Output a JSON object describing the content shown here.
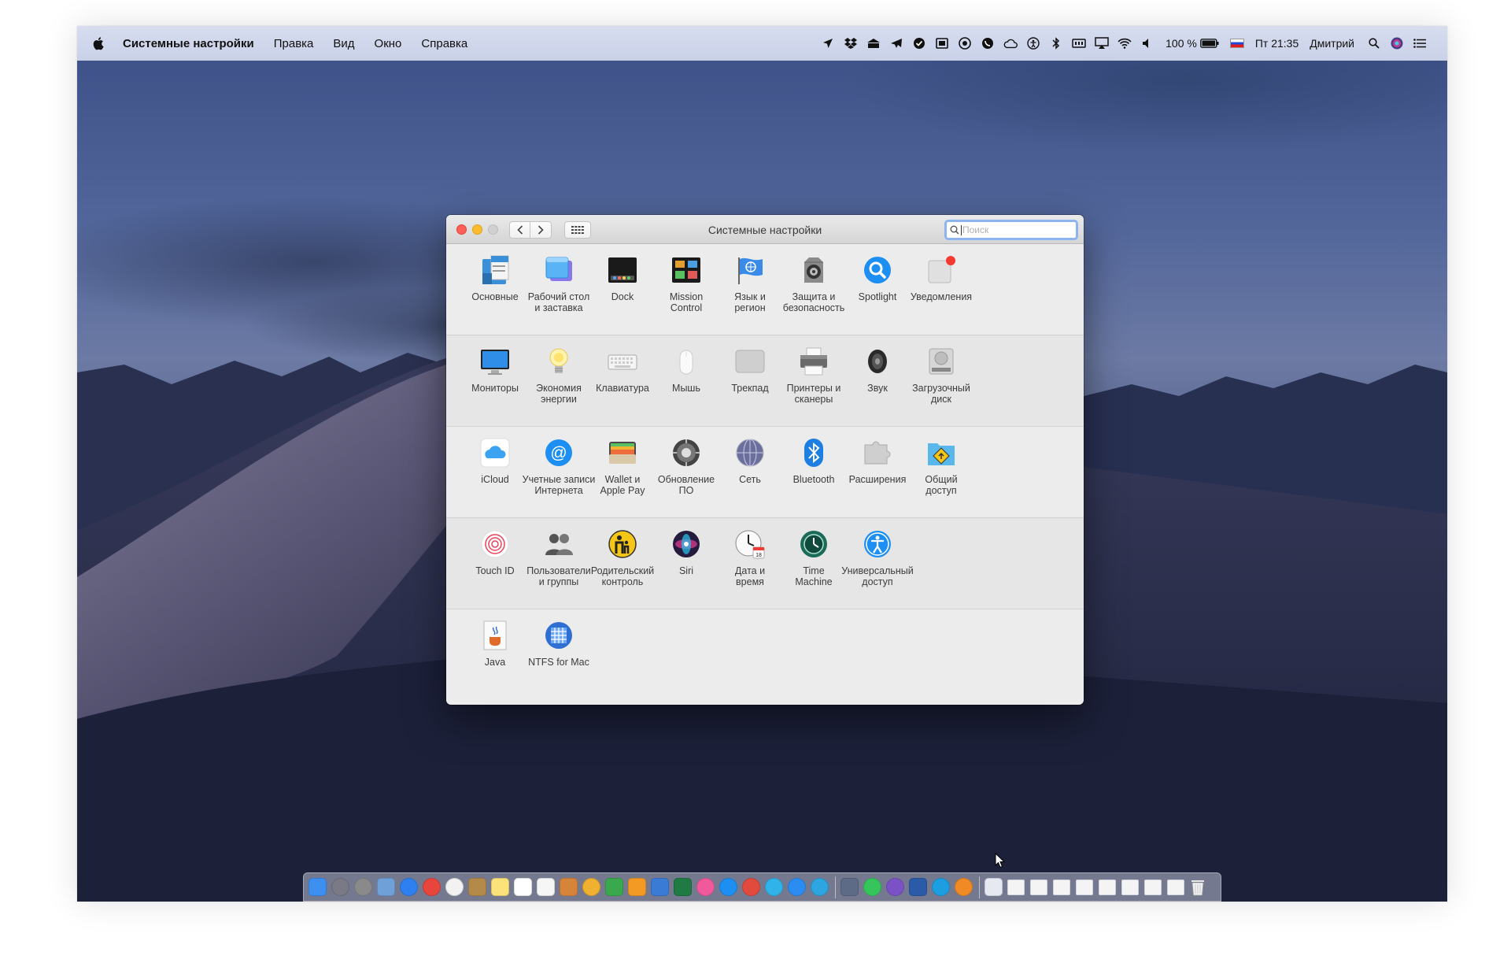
{
  "menubar": {
    "app_name": "Системные настройки",
    "items": [
      "Правка",
      "Вид",
      "Окно",
      "Справка"
    ],
    "battery": "100 %",
    "clock": "Пт 21:35",
    "user": "Дмитрий"
  },
  "window": {
    "title": "Системные настройки",
    "search_placeholder": "Поиск"
  },
  "rows": [
    [
      {
        "label": "Основные",
        "icon": "general-icon"
      },
      {
        "label": "Рабочий стол\nи заставка",
        "icon": "desktop-screensaver-icon"
      },
      {
        "label": "Dock",
        "icon": "dock-icon"
      },
      {
        "label": "Mission\nControl",
        "icon": "mission-control-icon"
      },
      {
        "label": "Язык и\nрегион",
        "icon": "language-region-icon"
      },
      {
        "label": "Защита и\nбезопасность",
        "icon": "security-icon"
      },
      {
        "label": "Spotlight",
        "icon": "spotlight-icon"
      },
      {
        "label": "Уведомления",
        "icon": "notifications-icon"
      }
    ],
    [
      {
        "label": "Мониторы",
        "icon": "displays-icon"
      },
      {
        "label": "Экономия\nэнергии",
        "icon": "energy-saver-icon"
      },
      {
        "label": "Клавиатура",
        "icon": "keyboard-icon"
      },
      {
        "label": "Мышь",
        "icon": "mouse-icon"
      },
      {
        "label": "Трекпад",
        "icon": "trackpad-icon"
      },
      {
        "label": "Принтеры и\nсканеры",
        "icon": "printers-icon"
      },
      {
        "label": "Звук",
        "icon": "sound-icon"
      },
      {
        "label": "Загрузочный\nдиск",
        "icon": "startup-disk-icon"
      }
    ],
    [
      {
        "label": "iCloud",
        "icon": "icloud-icon"
      },
      {
        "label": "Учетные записи\nИнтернета",
        "icon": "internet-accounts-icon"
      },
      {
        "label": "Wallet и\nApple Pay",
        "icon": "wallet-icon"
      },
      {
        "label": "Обновление\nПО",
        "icon": "software-update-icon"
      },
      {
        "label": "Сеть",
        "icon": "network-icon"
      },
      {
        "label": "Bluetooth",
        "icon": "bluetooth-icon"
      },
      {
        "label": "Расширения",
        "icon": "extensions-icon"
      },
      {
        "label": "Общий\nдоступ",
        "icon": "sharing-icon"
      }
    ],
    [
      {
        "label": "Touch ID",
        "icon": "touch-id-icon"
      },
      {
        "label": "Пользователи\nи группы",
        "icon": "users-groups-icon"
      },
      {
        "label": "Родительский\nконтроль",
        "icon": "parental-controls-icon"
      },
      {
        "label": "Siri",
        "icon": "siri-icon"
      },
      {
        "label": "Дата и\nвремя",
        "icon": "date-time-icon"
      },
      {
        "label": "Time\nMachine",
        "icon": "time-machine-icon"
      },
      {
        "label": "Универсальный\nдоступ",
        "icon": "accessibility-icon"
      }
    ],
    [
      {
        "label": "Java",
        "icon": "java-icon"
      },
      {
        "label": "NTFS for Mac",
        "icon": "ntfs-icon"
      }
    ]
  ],
  "dock": {
    "apps": [
      {
        "name": "finder-icon",
        "color": "#3d8ff0"
      },
      {
        "name": "launchpad-icon",
        "color": "#7a7a86"
      },
      {
        "name": "system-preferences-icon",
        "color": "#8a8a8a"
      },
      {
        "name": "preview-icon",
        "color": "#6fa0d8"
      },
      {
        "name": "safari-icon",
        "color": "#2e7ff0"
      },
      {
        "name": "chrome-icon",
        "color": "#e8453c"
      },
      {
        "name": "yandex-browser-icon",
        "color": "#f2f2f2"
      },
      {
        "name": "notefile-icon",
        "color": "#b38a4a"
      },
      {
        "name": "notes-icon",
        "color": "#fbe27a"
      },
      {
        "name": "calendar-icon",
        "color": "#ffffff"
      },
      {
        "name": "reminders-icon",
        "color": "#f6f6f6"
      },
      {
        "name": "books-icon",
        "color": "#d6843a"
      },
      {
        "name": "photos-icon",
        "color": "#f0b030"
      },
      {
        "name": "numbers-icon",
        "color": "#3aa84c"
      },
      {
        "name": "pages-icon",
        "color": "#f39a25"
      },
      {
        "name": "keynote-icon",
        "color": "#3a7bd5"
      },
      {
        "name": "excel-icon",
        "color": "#1f7a44"
      },
      {
        "name": "itunes-icon",
        "color": "#f05a9c"
      },
      {
        "name": "app-store-icon",
        "color": "#1d8ff2"
      },
      {
        "name": "tool-icon",
        "color": "#e14a3c"
      },
      {
        "name": "bitrix24-icon",
        "color": "#2fb3e8"
      },
      {
        "name": "messages-icon",
        "color": "#2b8df2"
      },
      {
        "name": "telegram-icon",
        "color": "#2ca5e0"
      },
      {
        "name": "sep"
      },
      {
        "name": "screenshot-icon",
        "color": "#5d6b86"
      },
      {
        "name": "whatsapp-icon",
        "color": "#35c55a"
      },
      {
        "name": "viber-icon",
        "color": "#7b52c6"
      },
      {
        "name": "word-icon",
        "color": "#2b5ba8"
      },
      {
        "name": "skype-icon",
        "color": "#1d9ee0"
      },
      {
        "name": "ibooks-icon",
        "color": "#f08a24"
      },
      {
        "name": "sep"
      },
      {
        "name": "document-icon",
        "color": "#e6e9f2"
      }
    ],
    "windows": 8
  }
}
